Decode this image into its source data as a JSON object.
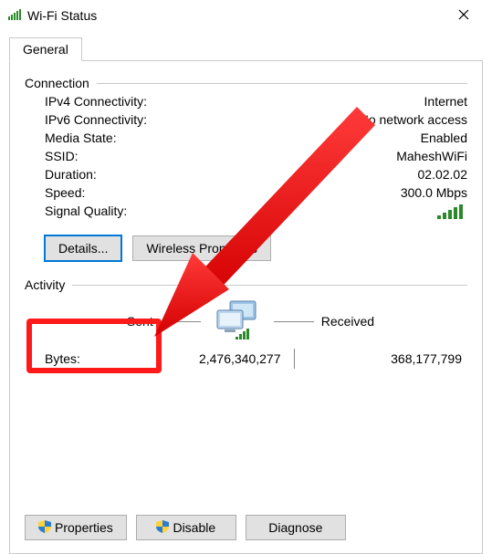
{
  "window_title": "Wi-Fi Status",
  "tab": {
    "general": "General"
  },
  "group": {
    "connection": "Connection",
    "activity": "Activity"
  },
  "conn": {
    "ipv4_k": "IPv4 Connectivity:",
    "ipv4_v": "Internet",
    "ipv6_k": "IPv6 Connectivity:",
    "ipv6_v": "No network access",
    "media_k": "Media State:",
    "media_v": "Enabled",
    "ssid_k": "SSID:",
    "ssid_v": "MaheshWiFi",
    "duration_k": "Duration:",
    "duration_v": "02.02.02",
    "speed_k": "Speed:",
    "speed_v": "300.0 Mbps",
    "signal_k": "Signal Quality:"
  },
  "buttons": {
    "details": "Details...",
    "wireless_props": "Wireless Properties",
    "properties": "Properties",
    "disable": "Disable",
    "diagnose": "Diagnose"
  },
  "activity": {
    "sent": "Sent",
    "received": "Received",
    "bytes_label": "Bytes:",
    "bytes_sent": "2,476,340,277",
    "bytes_received": "368,177,799"
  },
  "icons": {
    "title_signal": "wifi-signal-icon",
    "signal_quality": "signal-bars-icon",
    "activity_pic": "network-computers-icon",
    "shield": "uac-shield-icon",
    "close": "close-icon"
  },
  "colors": {
    "signal_green": "#2a8a2a",
    "annotation_red": "#ff1a1a"
  }
}
